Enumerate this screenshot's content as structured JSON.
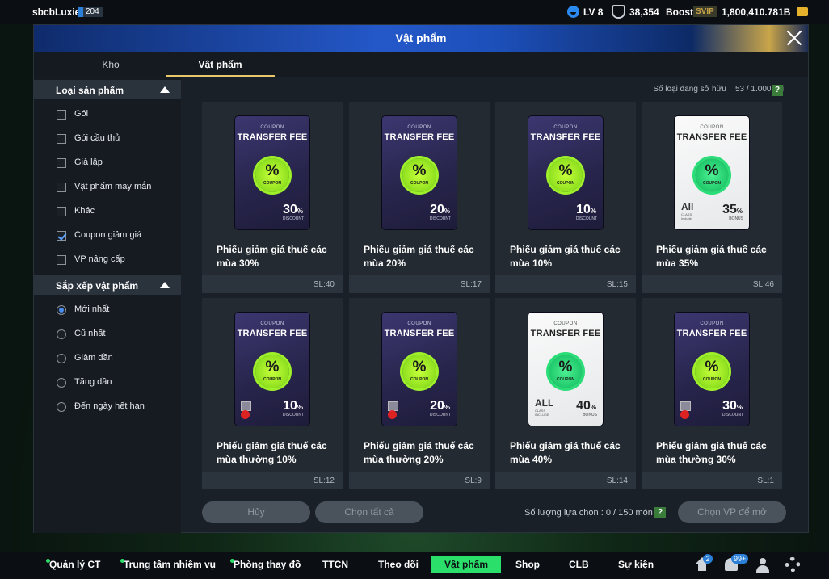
{
  "topbar": {
    "username": "sbcbLuxie",
    "user_level": "204",
    "lv": "LV 8",
    "shield_value": "38,354",
    "boost": "Boost",
    "svip": "SVIP",
    "coins": "1,800,410.781B"
  },
  "panel": {
    "title": "Vật phẩm",
    "tabs": [
      {
        "label": "Kho"
      },
      {
        "label": "Vật phẩm"
      }
    ]
  },
  "sidebar": {
    "filter_header": "Loại sản phẩm",
    "filters": [
      {
        "label": "Gói",
        "checked": false
      },
      {
        "label": "Gói cầu thủ",
        "checked": false
      },
      {
        "label": "Giả lập",
        "checked": false
      },
      {
        "label": "Vật phẩm may mắn",
        "checked": false
      },
      {
        "label": "Khác",
        "checked": false
      },
      {
        "label": "Coupon giảm giá",
        "checked": true
      },
      {
        "label": "VP nâng cấp",
        "checked": false
      }
    ],
    "sort_header": "Sắp xếp vật phẩm",
    "sorts": [
      {
        "label": "Mới nhất",
        "selected": true
      },
      {
        "label": "Cũ nhất",
        "selected": false
      },
      {
        "label": "Giảm dần",
        "selected": false
      },
      {
        "label": "Tăng dần",
        "selected": false
      },
      {
        "label": "Đến ngày hết hạn",
        "selected": false
      }
    ]
  },
  "inventory": {
    "owned_label": "Số loại đang sở hữu",
    "owned_value": "53 / 1.000 cái",
    "help": "?"
  },
  "coupon_text": {
    "top": "COUPON",
    "tf": "TRANSFER FEE",
    "pct": "%",
    "seal": "COUPON",
    "discount": "DISCOUNT",
    "bonus": "BONUS",
    "all": "All",
    "all_sub": "CLASS\nInclude",
    "all_caps": "ALL",
    "all_sub_caps": "CLASS\nINCLUDE"
  },
  "items": [
    {
      "name": "Phiếu giảm giá thuế các mùa 30%",
      "qty": "SL:40",
      "value": "30",
      "unit": "DISCOUNT",
      "white": false,
      "locked": false
    },
    {
      "name": "Phiếu giảm giá thuế các mùa 20%",
      "qty": "SL:17",
      "value": "20",
      "unit": "DISCOUNT",
      "white": false,
      "locked": false
    },
    {
      "name": "Phiếu giảm giá thuế các mùa 10%",
      "qty": "SL:15",
      "value": "10",
      "unit": "DISCOUNT",
      "white": false,
      "locked": false
    },
    {
      "name": "Phiếu giảm giá thuế các mùa 35%",
      "qty": "SL:46",
      "value": "35",
      "unit": "BONUS",
      "white": true,
      "locked": false
    },
    {
      "name": "Phiếu giảm giá thuế các mùa thường 10%",
      "qty": "SL:12",
      "value": "10",
      "unit": "DISCOUNT",
      "white": false,
      "locked": true
    },
    {
      "name": "Phiếu giảm giá thuế các mùa thường 20%",
      "qty": "SL:9",
      "value": "20",
      "unit": "DISCOUNT",
      "white": false,
      "locked": true
    },
    {
      "name": "Phiếu giảm giá thuế các mùa 40%",
      "qty": "SL:14",
      "value": "40",
      "unit": "BONUS",
      "white": true,
      "locked": false
    },
    {
      "name": "Phiếu giảm giá thuế các mùa thường 30%",
      "qty": "SL:1",
      "value": "30",
      "unit": "DISCOUNT",
      "white": false,
      "locked": true
    }
  ],
  "actions": {
    "cancel": "Hủy",
    "select_all": "Chọn tất cả",
    "selection_count": "Số lượng lựa chọn : 0 / 150 món",
    "help": "?",
    "open": "Chọn VP để mở"
  },
  "bottomnav": {
    "items": [
      {
        "label": "Quản lý CT",
        "dot": true
      },
      {
        "label": "Trung tâm nhiệm vụ",
        "dot": true
      },
      {
        "label": "Phòng thay đồ",
        "dot": true
      },
      {
        "label": "TTCN",
        "dot": false
      },
      {
        "label": "Theo dõi",
        "dot": false
      },
      {
        "label": "Vật phẩm",
        "dot": false,
        "active": true
      },
      {
        "label": "Shop",
        "dot": false
      },
      {
        "label": "CLB",
        "dot": false
      },
      {
        "label": "Sự kiện",
        "dot": false
      }
    ],
    "home_badge": "2",
    "bell_badge": "99+"
  },
  "colors": {
    "accent": "#2ae06a",
    "header_blue": "#2458c9",
    "panel_bg": "#1a2027"
  },
  "icons": [
    "smile-icon",
    "shield-icon",
    "coin-icon",
    "close-icon",
    "check-icon",
    "help-icon",
    "lock-icon",
    "home-icon",
    "bell-icon",
    "user-icon",
    "gear-icon"
  ]
}
